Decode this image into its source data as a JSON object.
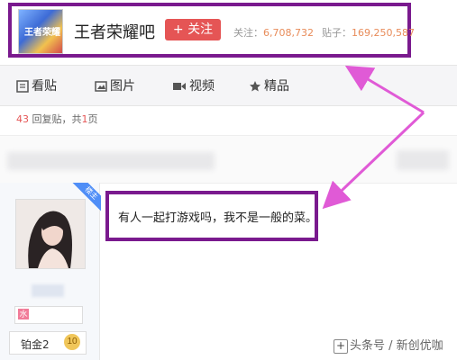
{
  "header": {
    "logo_text": "王者荣耀",
    "forum_name": "王者荣耀吧",
    "follow_label": "+ 关注",
    "followers_label": "关注：",
    "followers_value": "6,708,732",
    "posts_label": "贴子：",
    "posts_value": "169,250,587"
  },
  "tabs": [
    {
      "label": "看贴",
      "icon": "document-icon"
    },
    {
      "label": "图片",
      "icon": "image-icon"
    },
    {
      "label": "视频",
      "icon": "video-icon"
    },
    {
      "label": "精品",
      "icon": "star-icon"
    }
  ],
  "reply_info": {
    "count": "43",
    "text1": " 回复贴，共",
    "pages": "1",
    "text2": "页"
  },
  "post": {
    "host_badge": "楼主",
    "content": "有人一起打游戏吗，我不是一般的菜。",
    "sign_icon": "水",
    "level_name": "铂金2",
    "level_num": "10"
  },
  "watermark": "头条号 / 新创优咖",
  "colors": {
    "highlight_border": "#7a1a8e",
    "arrow": "#e05ad6",
    "follow_button": "#e55555"
  }
}
